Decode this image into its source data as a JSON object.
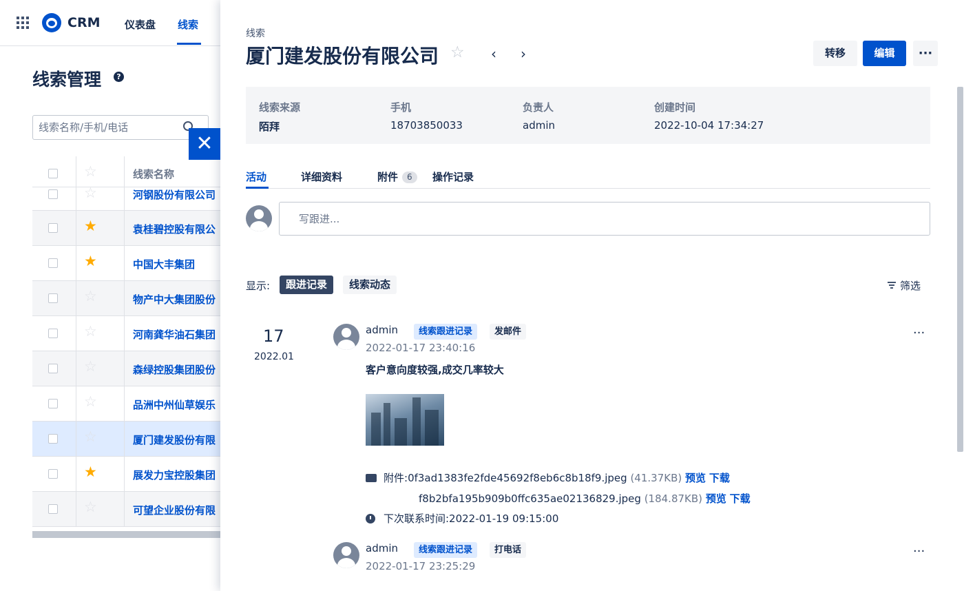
{
  "topnav": {
    "brand": "CRM",
    "items": [
      {
        "label": "仪表盘"
      },
      {
        "label": "线索"
      }
    ]
  },
  "page": {
    "title": "线索管理",
    "help_glyph": "?"
  },
  "search": {
    "placeholder": "线索名称/手机/电话",
    "value": ""
  },
  "close_glyph": "✕",
  "lead_table": {
    "header": "线索名称",
    "rows": [
      {
        "name": "河钢股份有限公司",
        "starred": false
      },
      {
        "name": "袁桂碧控股有限公",
        "starred": true
      },
      {
        "name": "中国大丰集团",
        "starred": true
      },
      {
        "name": "物产中大集团股份",
        "starred": false
      },
      {
        "name": "河南龚华油石集团",
        "starred": false
      },
      {
        "name": "森绿控股集团股份",
        "starred": false
      },
      {
        "name": "品洲中州仙草娱乐",
        "starred": false
      },
      {
        "name": "厦门建发股份有限",
        "starred": false
      },
      {
        "name": "展发力宝控股集团",
        "starred": true
      },
      {
        "name": "可望企业股份有限",
        "starred": false
      }
    ]
  },
  "drawer": {
    "breadcrumb": "线索",
    "title": "厦门建发股份有限公司",
    "fav_glyph": "☆",
    "prev_glyph": "‹",
    "next_glyph": "›",
    "actions": {
      "transfer": "转移",
      "edit": "编辑",
      "more": "···"
    },
    "summary": [
      {
        "label": "线索来源",
        "value": "陌拜"
      },
      {
        "label": "手机",
        "value": "18703850033"
      },
      {
        "label": "负责人",
        "value": "admin"
      },
      {
        "label": "创建时间",
        "value": "2022-10-04 17:34:27"
      }
    ],
    "tabs": {
      "activity": "活动",
      "details": "详细资料",
      "attachments": "附件",
      "attachments_count": "6",
      "log": "操作记录"
    },
    "composer": {
      "placeholder": "写跟进..."
    },
    "display": {
      "label": "显示:",
      "follow": "跟进记录",
      "dynamic": "线索动态",
      "filter": "筛选"
    },
    "date_group": {
      "day": "17",
      "month": "2022.01"
    },
    "activities": [
      {
        "author": "admin",
        "tag_type": "线索跟进记录",
        "tag_action": "发邮件",
        "time": "2022-01-17 23:40:16",
        "content": "客户意向度较强,成交几率较大",
        "attachments_label": "附件:",
        "attachments": [
          {
            "file": "0f3ad1383fe2fde45692f8eb6c8b18f9.jpeg",
            "size": "(41.37KB)",
            "preview": "预览",
            "download": "下载"
          },
          {
            "file": "f8b2bfa195b909b0ffc635ae02136829.jpeg",
            "size": "(184.87KB)",
            "preview": "预览",
            "download": "下载"
          }
        ],
        "next_contact": "下次联系时间:2022-01-19 09:15:00",
        "more": "···"
      },
      {
        "author": "admin",
        "tag_type": "线索跟进记录",
        "tag_action": "打电话",
        "time": "2022-01-17 23:25:29",
        "more": "···"
      }
    ]
  },
  "colors": {
    "primary": "#0052cc",
    "star_on": "#ffab00",
    "dark_pill": "#344563"
  }
}
